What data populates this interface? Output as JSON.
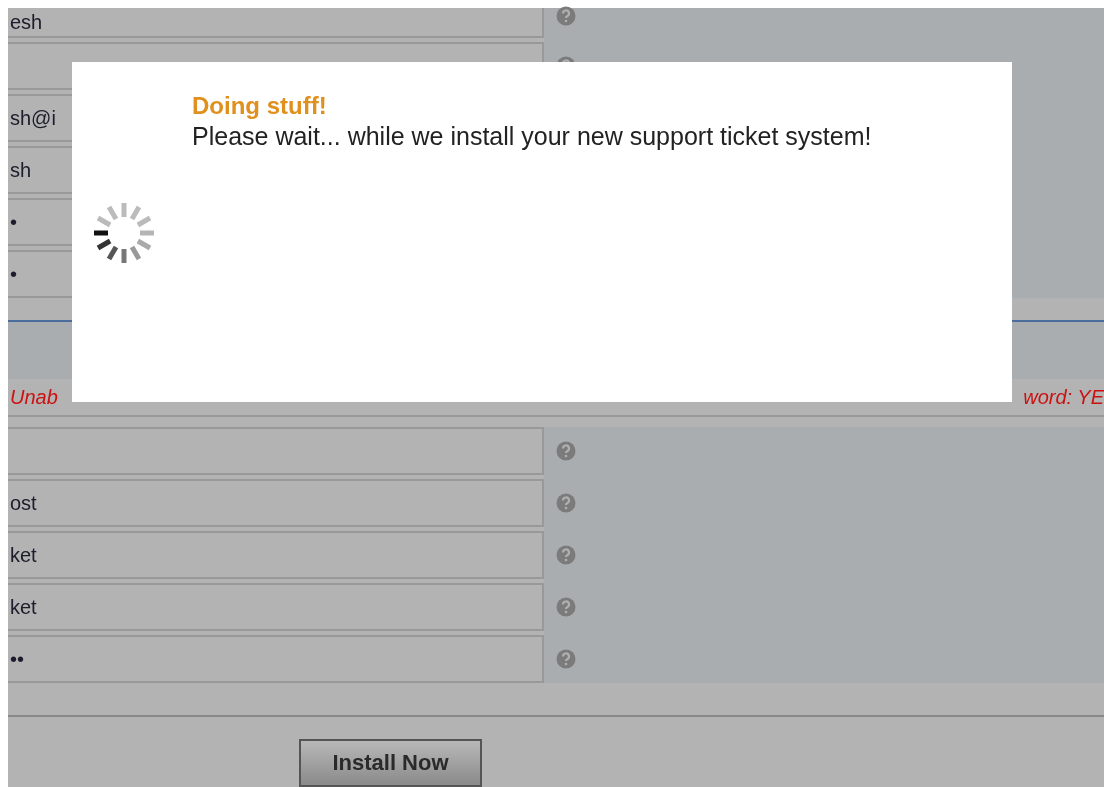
{
  "top_fields": [
    {
      "value": "esh",
      "help_icon": true
    },
    {
      "help_icon": true
    },
    {
      "value": "sh@i"
    },
    {
      "value": "sh"
    },
    {
      "value": "•"
    },
    {
      "value": "•"
    }
  ],
  "error": {
    "left": "Unab",
    "right": "word: YE"
  },
  "bottom_fields": [
    {
      "help_icon": true
    },
    {
      "value": "ost",
      "help_icon": true
    },
    {
      "value": "ket",
      "help_icon": true
    },
    {
      "value": "ket",
      "help_icon": true
    },
    {
      "value": "••",
      "help_icon": true
    }
  ],
  "install_button": "Install Now",
  "dialog": {
    "title": "Doing stuff!",
    "message": "Please wait... while we install your new support ticket system!"
  }
}
